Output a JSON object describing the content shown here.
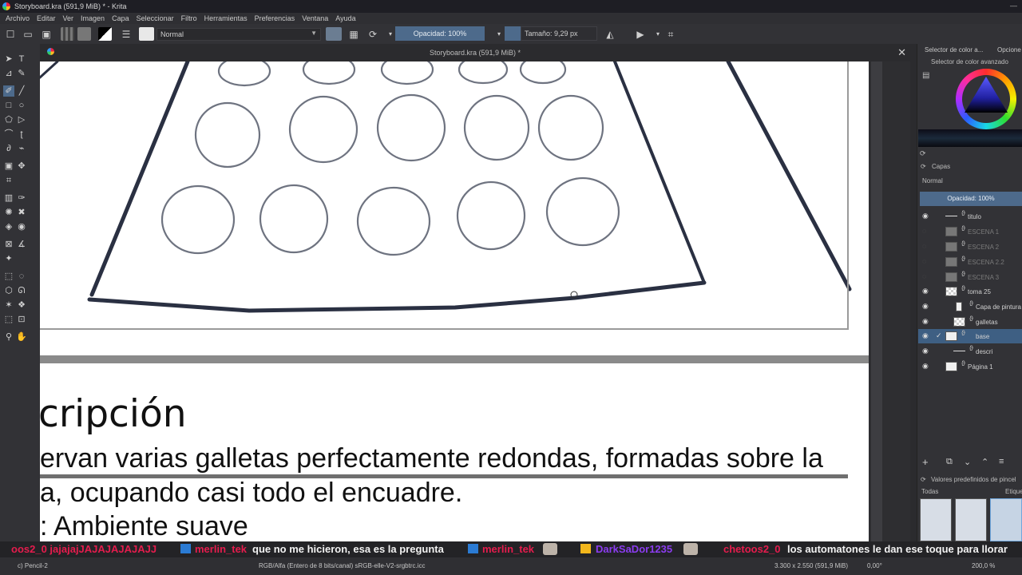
{
  "window": {
    "title": "Storyboard.kra (591,9 MiB) * - Krita"
  },
  "menu": [
    "Archivo",
    "Editar",
    "Ver",
    "Imagen",
    "Capa",
    "Seleccionar",
    "Filtro",
    "Herramientas",
    "Preferencias",
    "Ventana",
    "Ayuda"
  ],
  "toolbar": {
    "blend_mode": "Normal",
    "opacity": "Opacidad: 100%",
    "size": "Tamaño: 9,29 px"
  },
  "document": {
    "tab_title": "Storyboard.kra (591,9 MiB) *"
  },
  "page": {
    "heading": "cripción",
    "line1": "ervan varias galletas perfectamente redondas, formadas sobre la",
    "line2": "a, ocupando casi todo el encuadre.",
    "line3": ": Ambiente suave"
  },
  "dock": {
    "tab1": "Selector de color a...",
    "tab2": "Opcione",
    "color_selector_label": "Selector de color avanzado",
    "layers_title": "Capas",
    "layers_blend": "Normal",
    "layers_opacity": "Opacidad:  100%",
    "layers": [
      {
        "name": "titulo",
        "visible": true,
        "thumb": "line"
      },
      {
        "name": "ESCENA 1",
        "visible": false,
        "thumb": "dim"
      },
      {
        "name": "ESCENA 2",
        "visible": false,
        "thumb": "dim"
      },
      {
        "name": "ESCENA 2.2",
        "visible": false,
        "thumb": "dim"
      },
      {
        "name": "ESCENA 3",
        "visible": false,
        "thumb": "dim"
      },
      {
        "name": "toma 25",
        "visible": true,
        "thumb": "checker"
      },
      {
        "name": "Capa de pintura",
        "visible": true,
        "thumb": "white"
      },
      {
        "name": "galletas",
        "visible": true,
        "thumb": "checker"
      },
      {
        "name": "base",
        "visible": true,
        "thumb": "white",
        "selected": true
      },
      {
        "name": "descri",
        "visible": true,
        "thumb": "line"
      },
      {
        "name": "Página 1",
        "visible": true,
        "thumb": "white"
      }
    ],
    "brush_presets_title": "Valores predefinidos de pincel",
    "brush_filter": "Todas",
    "brush_tag": "Etique"
  },
  "ticker": {
    "m1": "oos2_0 jajajajJAJAJAJAJAJJ",
    "u2": "merlin_tek",
    "m2": "que no me hicieron, esa es la pregunta",
    "u3": "merlin_tek",
    "u4": "DarkSaDor1235",
    "u5": "chetoos2_0",
    "m5": "los automatones le dan ese toque para llorar"
  },
  "status": {
    "tool": "c) Pencil-2",
    "color": "RGB/Alfa (Entero de 8 bits/canal)  sRGB-elle-V2-srgbtrc.icc",
    "dims": "3.300 x 2.550 (591,9 MiB)",
    "rotation": "0,00°",
    "zoom": "200,0 %"
  },
  "colors": {
    "accent": "#4d6a8b",
    "selected_layer": "#3e5f83",
    "chat_user": "#e51c4d"
  }
}
